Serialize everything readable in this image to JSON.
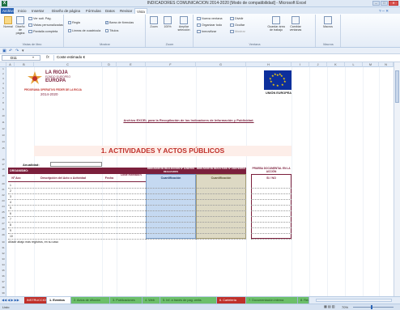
{
  "window": {
    "title": "INDICADORES COMUNICACIÓN 2014-2020 [Modo de compatibilidad] - Microsoft Excel",
    "app_icon": "X"
  },
  "ribbon_tabs": [
    "Archivo",
    "Inicio",
    "Insertar",
    "Diseño de página",
    "Fórmulas",
    "Datos",
    "Revisar",
    "Vista"
  ],
  "ribbon": {
    "groups": {
      "views": {
        "label": "Vistas de libro",
        "normal": "Normal",
        "page_layout": "Diseño de página",
        "page_break": "Ver salt. Pág.",
        "custom_views": "Vistas personalizadas",
        "fullscreen": "Pantalla completa"
      },
      "show": {
        "label": "Mostrar",
        "ruler": "Regla",
        "gridlines": "Líneas de cuadrícula",
        "formula_bar": "Barra de fórmulas",
        "headings": "Títulos"
      },
      "zoom": {
        "label": "Zoom",
        "zoom": "Zoom",
        "hundred": "100%",
        "fit": "Ampliar selección"
      },
      "window": {
        "label": "Ventana",
        "new_window": "Nueva ventana",
        "arrange": "Organizar todo",
        "freeze": "Inmovilizar",
        "split": "Dividir",
        "hide": "Ocultar",
        "unhide": "Mostrar",
        "save_workspace": "Guardar área de trabajo",
        "switch": "Cambiar ventanas"
      },
      "macros": {
        "label": "Macros",
        "macros": "Macros"
      }
    }
  },
  "formula_bar": {
    "name_box": "D11",
    "fx": "fx",
    "formula": "Coste estimado €"
  },
  "columns": [
    "A",
    "B",
    "C",
    "D",
    "E",
    "F",
    "G",
    "H",
    "I",
    "J",
    "K",
    "L",
    "M",
    "N"
  ],
  "sheet": {
    "logo": {
      "line1": "LA RIOJA",
      "line2": "FONDO EUROPEO",
      "line3": "EUROPA",
      "programa": "PROGRAMA OPERATIVO FEDER DE LA RIOJA",
      "period": "2014-2020"
    },
    "eu_label": "UNIÓN EUROPEA",
    "subtitle": "Archivo EXCEL para la Recopilación de los Indicadores de Información y Publicidad.",
    "main_heading": "1. ACTIVIDADES Y ACTOS PÚBLICOS",
    "anualidad_label": "Anualidad:",
    "organismo_label": "ORGANISMO:",
    "indicador_realizacion": "INDICADOR DE REALIZACIÓN Nº EVENTOS REALIZADOS",
    "indicador_resultado": "INDICADOR DE RESULTADO Nº ASISTENTES",
    "prueba_documental": "PRUEBA DOCUMENTAL EN LA ACCIÓN",
    "table_headers": {
      "num_acc": "Nº Acc",
      "descripcion": "Descripción del Acto o Actividad",
      "fecha": "Fecha",
      "coste": "Coste estimado €",
      "cuantificacion1": "Cuantificación",
      "cuantificacion2": "Cuantificación",
      "si_no": "SI / NO"
    },
    "row_numbers": [
      "1",
      "2",
      "3",
      "4",
      "5",
      "6",
      "7",
      "8",
      "9",
      "10"
    ],
    "footnote": "Añadir abajo más registros, en su caso"
  },
  "sheet_tabs": [
    "INSTRUCCIONES",
    "1. Eventos",
    "2. Actos de difusión",
    "3. Publicaciones",
    "4. Web",
    "5. Inf. a través de pag. webs",
    "6. Cartelería",
    "7. Documentación interna",
    "8. Redes"
  ],
  "active_sheet_tab": "1. Eventos",
  "status": {
    "zoom": "70%"
  },
  "colors": {
    "header_maroon": "#7b1f3c",
    "blue_fill": "#c5d9f1",
    "tan_fill": "#ddd9c4",
    "heading_red": "#c0302a",
    "eu_blue": "#0c2f9c"
  }
}
